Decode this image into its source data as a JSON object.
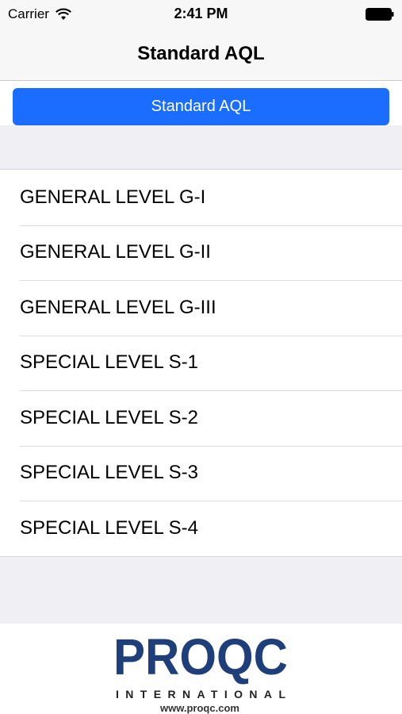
{
  "status_bar": {
    "carrier": "Carrier",
    "time": "2:41 PM",
    "wifi_icon": "wifi-icon",
    "battery_icon": "battery-icon"
  },
  "nav": {
    "title": "Standard AQL"
  },
  "actions": {
    "primary_label": "Standard AQL",
    "primary_color": "#1a6dfe"
  },
  "list": {
    "items": [
      {
        "label": "GENERAL LEVEL G-I"
      },
      {
        "label": "GENERAL LEVEL G-II"
      },
      {
        "label": "GENERAL LEVEL G-III"
      },
      {
        "label": "SPECIAL LEVEL S-1"
      },
      {
        "label": "SPECIAL LEVEL S-2"
      },
      {
        "label": "SPECIAL LEVEL S-3"
      },
      {
        "label": "SPECIAL LEVEL S-4"
      }
    ]
  },
  "footer": {
    "logo_mark": "PROQC",
    "logo_sub": "INTERNATIONAL",
    "website": "www.proqc.com",
    "logo_color": "#1e3f7a"
  }
}
